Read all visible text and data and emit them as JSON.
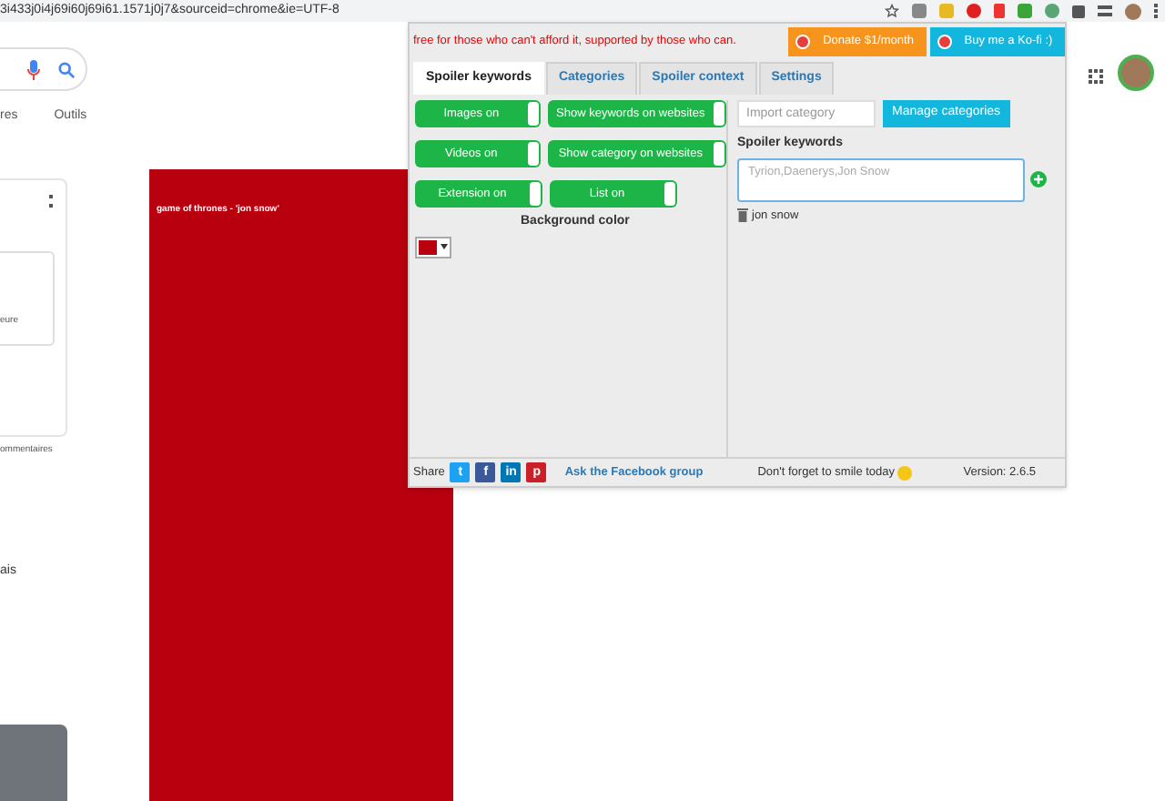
{
  "browser": {
    "url": "3i433j0i4j69i60j69i61.1571j0j7&sourceid=chrome&ie=UTF-8"
  },
  "page": {
    "tabs": [
      "res",
      "Outils"
    ],
    "snippets": [
      "eure",
      "ommentaires",
      "ais"
    ],
    "overlay": {
      "label": "game of thrones - 'jon snow'"
    }
  },
  "popup": {
    "tagline": "free for those who can't afford it, supported by those who can.",
    "donate_buttons": [
      {
        "kind": "donate",
        "label": "Donate $1/month"
      },
      {
        "kind": "kofi",
        "label": "Buy me a Ko-fi :)"
      }
    ],
    "tabs": [
      {
        "label": "Spoiler keywords",
        "selected": true
      },
      {
        "label": "Categories",
        "selected": false
      },
      {
        "label": "Spoiler context",
        "selected": false
      },
      {
        "label": "Settings",
        "selected": false
      }
    ],
    "toggles": [
      [
        {
          "label": "Images on",
          "on": true
        },
        {
          "label": "Show keywords on websites",
          "on": true
        }
      ],
      [
        {
          "label": "Videos on",
          "on": true
        },
        {
          "label": "Show category on websites",
          "on": true
        }
      ],
      [
        {
          "label": "Extension on",
          "on": true
        },
        {
          "label": "List on",
          "on": true
        }
      ]
    ],
    "background_color": {
      "label": "Background color",
      "color": "#b8000f"
    },
    "import": {
      "placeholder": "Import category"
    },
    "manage_button": "Manage categories",
    "keywords_heading": "Spoiler keywords",
    "keywords_input": {
      "placeholder": "Tyrion,Daenerys,Jon Snow"
    },
    "keywords": [
      "jon snow"
    ],
    "footer": {
      "share": "Share",
      "socials": [
        {
          "kind": "twitter",
          "label": "t"
        },
        {
          "kind": "facebook",
          "label": "f"
        },
        {
          "kind": "linkedin",
          "label": "in"
        },
        {
          "kind": "pinterest",
          "label": "p"
        }
      ],
      "link": "Ask the Facebook group",
      "smile": "Don't forget to smile today",
      "version": "Version: 2.6.5"
    }
  }
}
